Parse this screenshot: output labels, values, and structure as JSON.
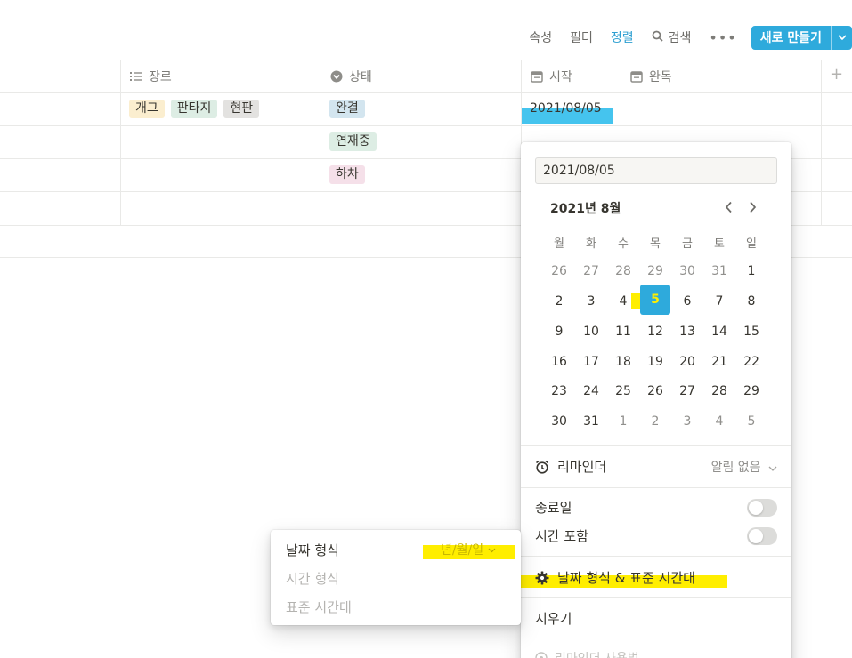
{
  "toolbar": {
    "properties": "속성",
    "filter": "필터",
    "sort": "정렬",
    "search": "검색",
    "more": "•••",
    "new": "새로 만들기"
  },
  "table": {
    "columns": {
      "genre": "장르",
      "status": "상태",
      "start": "시작",
      "finish": "완독"
    },
    "rows": [
      {
        "genres": [
          "개그",
          "판타지",
          "현판"
        ],
        "status": "완결",
        "start": "2021/08/05"
      },
      {
        "genres": [],
        "status": "연재중",
        "start": ""
      },
      {
        "genres": [],
        "status": "하차",
        "start": ""
      }
    ]
  },
  "datepicker": {
    "input_value": "2021/08/05",
    "month_label": "2021년 8월",
    "weekdays": [
      "월",
      "화",
      "수",
      "목",
      "금",
      "토",
      "일"
    ],
    "weeks": [
      [
        "26",
        "27",
        "28",
        "29",
        "30",
        "31",
        "1"
      ],
      [
        "2",
        "3",
        "4",
        "5",
        "6",
        "7",
        "8"
      ],
      [
        "9",
        "10",
        "11",
        "12",
        "13",
        "14",
        "15"
      ],
      [
        "16",
        "17",
        "18",
        "19",
        "20",
        "21",
        "22"
      ],
      [
        "23",
        "24",
        "25",
        "26",
        "27",
        "28",
        "29"
      ],
      [
        "30",
        "31",
        "1",
        "2",
        "3",
        "4",
        "5"
      ]
    ],
    "selected_day": "5",
    "reminder_label": "리마인더",
    "reminder_value": "알림 없음",
    "end_date_label": "종료일",
    "include_time_label": "시간 포함",
    "format_label": "날짜 형식 & 표준 시간대",
    "clear_label": "지우기",
    "reminder_help": "리마인더 사용법"
  },
  "format_menu": {
    "date_format_label": "날짜 형식",
    "date_format_value": "년/월/일",
    "time_format_label": "시간 형식",
    "timezone_label": "표준 시간대"
  },
  "colors": {
    "accent": "#2eaadc",
    "highlight": "#ffee00"
  }
}
